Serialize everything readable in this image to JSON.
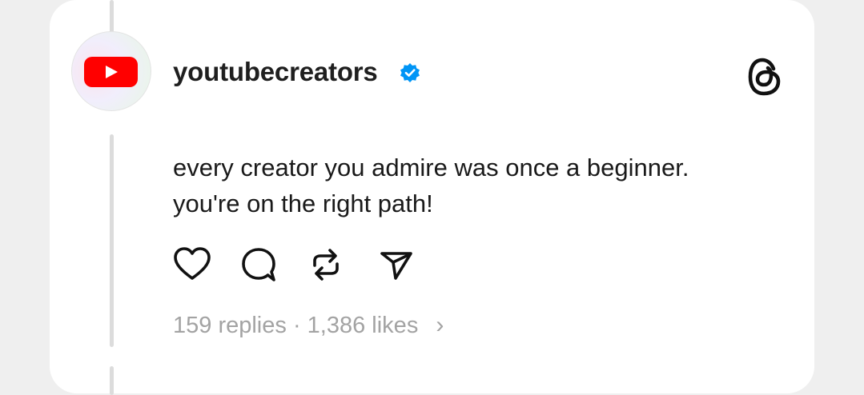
{
  "post": {
    "username": "youtubecreators",
    "verified": true,
    "avatar": "youtube-logo-icon",
    "text_lines": [
      "every creator you admire was once a beginner.",
      "you're on the right path!"
    ],
    "replies": "159 replies",
    "separator": "·",
    "likes": "1,386 likes",
    "chevron": "›"
  },
  "icons": {
    "app_logo": "threads-logo-icon",
    "actions": [
      "heart-icon",
      "comment-icon",
      "repost-icon",
      "share-icon"
    ]
  },
  "colors": {
    "verified": "#0095f6",
    "youtube_red": "#ff0000",
    "stats_text": "#a3a3a3"
  }
}
